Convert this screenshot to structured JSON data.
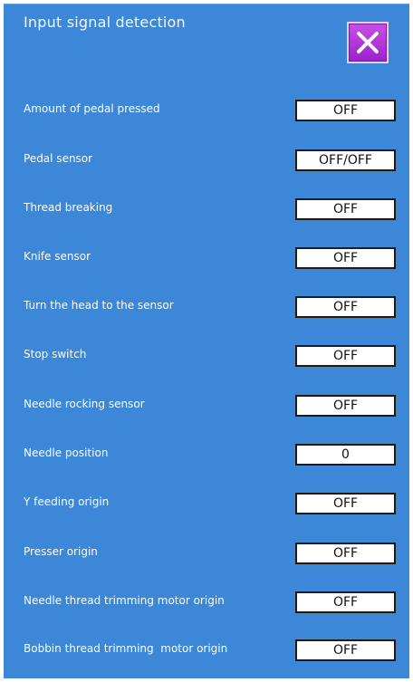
{
  "header": {
    "title": "Input signal detection",
    "close_icon": "close-icon"
  },
  "colors": {
    "panel_background": "#3d87d9",
    "close_button": "#b03fdc",
    "value_box": "#ffffff"
  },
  "signals": [
    {
      "label": "Amount of pedal pressed",
      "value": "OFF"
    },
    {
      "label": "Pedal sensor",
      "value": "OFF/OFF"
    },
    {
      "label": "Thread breaking",
      "value": "OFF"
    },
    {
      "label": "Knife sensor",
      "value": "OFF"
    },
    {
      "label": "Turn the head to the sensor",
      "value": "OFF"
    },
    {
      "label": "Stop switch",
      "value": "OFF"
    },
    {
      "label": "Needle rocking sensor",
      "value": "OFF"
    },
    {
      "label": "Needle position",
      "value": "0"
    },
    {
      "label": "Y feeding origin",
      "value": "OFF"
    },
    {
      "label": "Presser origin",
      "value": "OFF"
    },
    {
      "label": "Needle thread trimming motor origin",
      "value": "OFF"
    },
    {
      "label": "Bobbin thread trimming  motor origin",
      "value": "OFF"
    }
  ]
}
